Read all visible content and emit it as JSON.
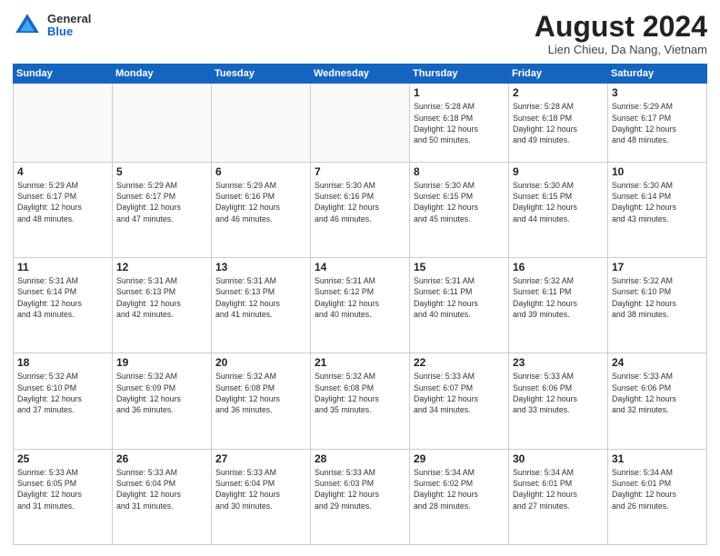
{
  "header": {
    "logo_general": "General",
    "logo_blue": "Blue",
    "month_title": "August 2024",
    "location": "Lien Chieu, Da Nang, Vietnam"
  },
  "days_of_week": [
    "Sunday",
    "Monday",
    "Tuesday",
    "Wednesday",
    "Thursday",
    "Friday",
    "Saturday"
  ],
  "weeks": [
    [
      {
        "day": "",
        "info": ""
      },
      {
        "day": "",
        "info": ""
      },
      {
        "day": "",
        "info": ""
      },
      {
        "day": "",
        "info": ""
      },
      {
        "day": "1",
        "info": "Sunrise: 5:28 AM\nSunset: 6:18 PM\nDaylight: 12 hours\nand 50 minutes."
      },
      {
        "day": "2",
        "info": "Sunrise: 5:28 AM\nSunset: 6:18 PM\nDaylight: 12 hours\nand 49 minutes."
      },
      {
        "day": "3",
        "info": "Sunrise: 5:29 AM\nSunset: 6:17 PM\nDaylight: 12 hours\nand 48 minutes."
      }
    ],
    [
      {
        "day": "4",
        "info": "Sunrise: 5:29 AM\nSunset: 6:17 PM\nDaylight: 12 hours\nand 48 minutes."
      },
      {
        "day": "5",
        "info": "Sunrise: 5:29 AM\nSunset: 6:17 PM\nDaylight: 12 hours\nand 47 minutes."
      },
      {
        "day": "6",
        "info": "Sunrise: 5:29 AM\nSunset: 6:16 PM\nDaylight: 12 hours\nand 46 minutes."
      },
      {
        "day": "7",
        "info": "Sunrise: 5:30 AM\nSunset: 6:16 PM\nDaylight: 12 hours\nand 46 minutes."
      },
      {
        "day": "8",
        "info": "Sunrise: 5:30 AM\nSunset: 6:15 PM\nDaylight: 12 hours\nand 45 minutes."
      },
      {
        "day": "9",
        "info": "Sunrise: 5:30 AM\nSunset: 6:15 PM\nDaylight: 12 hours\nand 44 minutes."
      },
      {
        "day": "10",
        "info": "Sunrise: 5:30 AM\nSunset: 6:14 PM\nDaylight: 12 hours\nand 43 minutes."
      }
    ],
    [
      {
        "day": "11",
        "info": "Sunrise: 5:31 AM\nSunset: 6:14 PM\nDaylight: 12 hours\nand 43 minutes."
      },
      {
        "day": "12",
        "info": "Sunrise: 5:31 AM\nSunset: 6:13 PM\nDaylight: 12 hours\nand 42 minutes."
      },
      {
        "day": "13",
        "info": "Sunrise: 5:31 AM\nSunset: 6:13 PM\nDaylight: 12 hours\nand 41 minutes."
      },
      {
        "day": "14",
        "info": "Sunrise: 5:31 AM\nSunset: 6:12 PM\nDaylight: 12 hours\nand 40 minutes."
      },
      {
        "day": "15",
        "info": "Sunrise: 5:31 AM\nSunset: 6:11 PM\nDaylight: 12 hours\nand 40 minutes."
      },
      {
        "day": "16",
        "info": "Sunrise: 5:32 AM\nSunset: 6:11 PM\nDaylight: 12 hours\nand 39 minutes."
      },
      {
        "day": "17",
        "info": "Sunrise: 5:32 AM\nSunset: 6:10 PM\nDaylight: 12 hours\nand 38 minutes."
      }
    ],
    [
      {
        "day": "18",
        "info": "Sunrise: 5:32 AM\nSunset: 6:10 PM\nDaylight: 12 hours\nand 37 minutes."
      },
      {
        "day": "19",
        "info": "Sunrise: 5:32 AM\nSunset: 6:09 PM\nDaylight: 12 hours\nand 36 minutes."
      },
      {
        "day": "20",
        "info": "Sunrise: 5:32 AM\nSunset: 6:08 PM\nDaylight: 12 hours\nand 36 minutes."
      },
      {
        "day": "21",
        "info": "Sunrise: 5:32 AM\nSunset: 6:08 PM\nDaylight: 12 hours\nand 35 minutes."
      },
      {
        "day": "22",
        "info": "Sunrise: 5:33 AM\nSunset: 6:07 PM\nDaylight: 12 hours\nand 34 minutes."
      },
      {
        "day": "23",
        "info": "Sunrise: 5:33 AM\nSunset: 6:06 PM\nDaylight: 12 hours\nand 33 minutes."
      },
      {
        "day": "24",
        "info": "Sunrise: 5:33 AM\nSunset: 6:06 PM\nDaylight: 12 hours\nand 32 minutes."
      }
    ],
    [
      {
        "day": "25",
        "info": "Sunrise: 5:33 AM\nSunset: 6:05 PM\nDaylight: 12 hours\nand 31 minutes."
      },
      {
        "day": "26",
        "info": "Sunrise: 5:33 AM\nSunset: 6:04 PM\nDaylight: 12 hours\nand 31 minutes."
      },
      {
        "day": "27",
        "info": "Sunrise: 5:33 AM\nSunset: 6:04 PM\nDaylight: 12 hours\nand 30 minutes."
      },
      {
        "day": "28",
        "info": "Sunrise: 5:33 AM\nSunset: 6:03 PM\nDaylight: 12 hours\nand 29 minutes."
      },
      {
        "day": "29",
        "info": "Sunrise: 5:34 AM\nSunset: 6:02 PM\nDaylight: 12 hours\nand 28 minutes."
      },
      {
        "day": "30",
        "info": "Sunrise: 5:34 AM\nSunset: 6:01 PM\nDaylight: 12 hours\nand 27 minutes."
      },
      {
        "day": "31",
        "info": "Sunrise: 5:34 AM\nSunset: 6:01 PM\nDaylight: 12 hours\nand 26 minutes."
      }
    ]
  ]
}
